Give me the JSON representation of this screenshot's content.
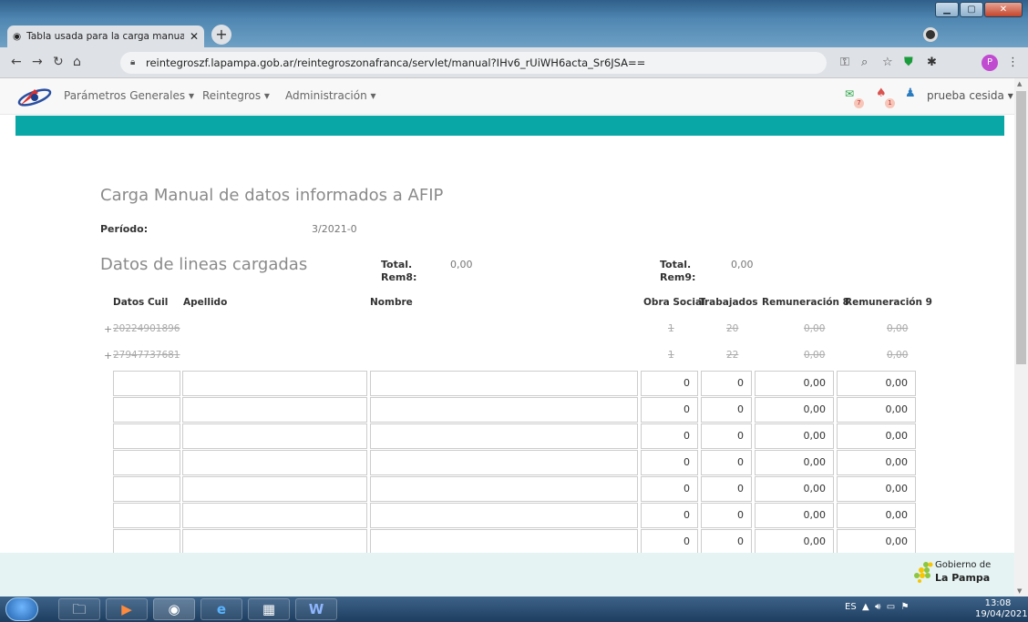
{
  "browser": {
    "tab_title": "Tabla usada para la carga manua",
    "url": "reintegroszf.lapampa.gob.ar/reintegroszonafranca/servlet/manual?IHv6_rUiWH6acta_Sr6JSA==",
    "profile_initial": "P"
  },
  "app_nav": {
    "menu": [
      "Parámetros Generales",
      "Reintegros",
      "Administración"
    ],
    "mail_count": "7",
    "alert_count": "1",
    "user": "prueba cesida"
  },
  "page": {
    "title": "Carga Manual de datos informados a AFIP",
    "periodo_label": "Período:",
    "periodo_value": "3/2021-0",
    "subtitle": "Datos de lineas cargadas",
    "total_rem8_label_1": "Total.",
    "total_rem8_label_2": "Rem8:",
    "total_rem8_value": "0,00",
    "total_rem9_label_1": "Total.",
    "total_rem9_label_2": "Rem9:",
    "total_rem9_value": "0,00"
  },
  "table": {
    "headers": [
      "Datos Cuil",
      "Apellido",
      "Nombre",
      "Obra Social",
      "Trabajados",
      "Remuneración 8",
      "Remuneración 9"
    ],
    "loaded_rows": [
      {
        "cuil": "20224901896",
        "obra_social": "1",
        "trabajados": "20",
        "rem8": "0,00",
        "rem9": "0,00"
      },
      {
        "cuil": "27947737681",
        "obra_social": "1",
        "trabajados": "22",
        "rem8": "0,00",
        "rem9": "0,00"
      }
    ],
    "input_rows": [
      {
        "obra_social": "0",
        "trabajados": "0",
        "rem8": "0,00",
        "rem9": "0,00"
      },
      {
        "obra_social": "0",
        "trabajados": "0",
        "rem8": "0,00",
        "rem9": "0,00"
      },
      {
        "obra_social": "0",
        "trabajados": "0",
        "rem8": "0,00",
        "rem9": "0,00"
      },
      {
        "obra_social": "0",
        "trabajados": "0",
        "rem8": "0,00",
        "rem9": "0,00"
      },
      {
        "obra_social": "0",
        "trabajados": "0",
        "rem8": "0,00",
        "rem9": "0,00"
      },
      {
        "obra_social": "0",
        "trabajados": "0",
        "rem8": "0,00",
        "rem9": "0,00"
      },
      {
        "obra_social": "0",
        "trabajados": "0",
        "rem8": "0,00",
        "rem9": "0,00"
      }
    ]
  },
  "footer": {
    "logo_line1": "Gobierno de",
    "logo_line2": "La Pampa"
  },
  "taskbar": {
    "lang": "ES",
    "time": "13:08",
    "date": "19/04/2021"
  }
}
